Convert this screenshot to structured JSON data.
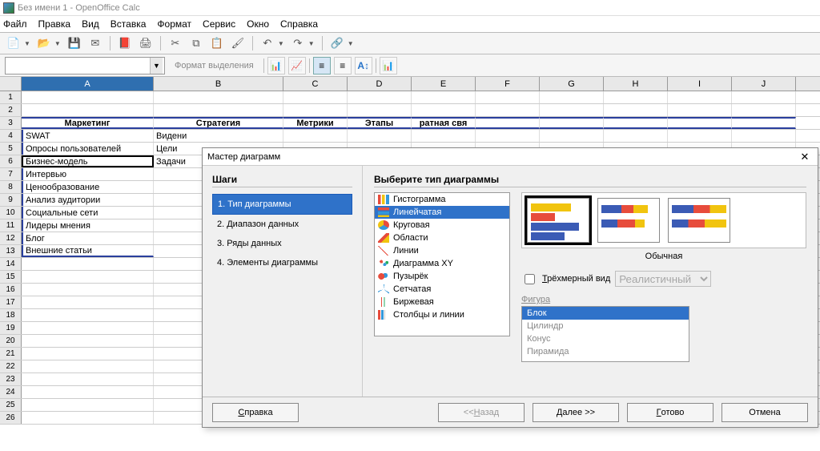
{
  "window": {
    "title": "Без имени 1 - OpenOffice Calc"
  },
  "menu": {
    "items": [
      "Файл",
      "Правка",
      "Вид",
      "Вставка",
      "Формат",
      "Сервис",
      "Окно",
      "Справка"
    ]
  },
  "toolbar2": {
    "format_label": "Формат выделения"
  },
  "columns": {
    "widths": [
      165,
      162,
      80,
      80,
      80,
      80,
      80,
      80,
      80,
      80
    ],
    "labels": [
      "A",
      "B",
      "C",
      "D",
      "E",
      "F",
      "G",
      "H",
      "I",
      "J"
    ],
    "active": 0
  },
  "sheet": {
    "headers_row": 3,
    "headers": [
      "Маркетинг",
      "Стратегия",
      "Метрики",
      "Этапы",
      "ратная свя"
    ],
    "rows": [
      {
        "n": 4,
        "cells": [
          "SWAT",
          "Видени"
        ]
      },
      {
        "n": 5,
        "cells": [
          "Опросы пользователей",
          "Цели"
        ]
      },
      {
        "n": 6,
        "cells": [
          "Бизнес-модель",
          "Задачи"
        ],
        "selected": true
      },
      {
        "n": 7,
        "cells": [
          "Интервью",
          ""
        ]
      },
      {
        "n": 8,
        "cells": [
          "Ценообразование",
          ""
        ]
      },
      {
        "n": 9,
        "cells": [
          "Анализ аудитории",
          ""
        ]
      },
      {
        "n": 10,
        "cells": [
          "Социальные сети",
          ""
        ]
      },
      {
        "n": 11,
        "cells": [
          "Лидеры мнения",
          ""
        ]
      },
      {
        "n": 12,
        "cells": [
          "Блог",
          ""
        ]
      },
      {
        "n": 13,
        "cells": [
          "Внешние статьи",
          ""
        ]
      }
    ],
    "total_rows": 26
  },
  "dialog": {
    "title": "Мастер диаграмм",
    "steps_label": "Шаги",
    "steps": [
      "1. Тип диаграммы",
      "2. Диапазон данных",
      "3. Ряды данных",
      "4. Элементы диаграммы"
    ],
    "active_step": 0,
    "choose_type_label": "Выберите тип диаграммы",
    "chart_types": [
      "Гистограмма",
      "Линейчатая",
      "Круговая",
      "Области",
      "Линии",
      "Диаграмма XY",
      "Пузырёк",
      "Сетчатая",
      "Биржевая",
      "Столбцы и линии"
    ],
    "selected_type": 1,
    "subtype_label": "Обычная",
    "threeD_label": "Трёхмерный вид",
    "threeD_option": "Реалистичный",
    "shape_label": "Фигура",
    "shapes": [
      "Блок",
      "Цилиндр",
      "Конус",
      "Пирамида"
    ],
    "selected_shape": 0,
    "buttons": {
      "help": "Справка",
      "back": "<< Назад",
      "next": "Далее >>",
      "finish": "Готово",
      "cancel": "Отмена"
    }
  }
}
